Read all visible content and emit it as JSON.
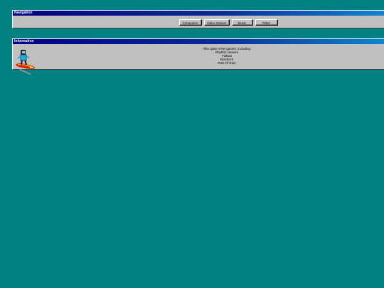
{
  "navigation": {
    "title": "Navigation",
    "buttons": [
      "Computers",
      "Video Games",
      "Music",
      "Other"
    ]
  },
  "information": {
    "title": "Information",
    "intro": "I like quite a few games, including:",
    "games": [
      "Rhythm Heaven",
      "Fallout",
      "Bioshock",
      "Risk Of Rain"
    ]
  },
  "icons": {
    "mascot": "surfer-mascot-icon"
  },
  "colors": {
    "desktop": "#008080",
    "window": "#c0c0c0",
    "titlebar_start": "#000080",
    "titlebar_end": "#1084d0"
  }
}
